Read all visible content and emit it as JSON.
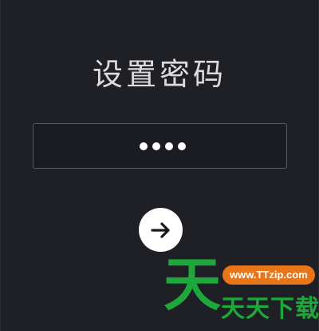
{
  "title": "设置密码",
  "password": {
    "masked_value": "••••",
    "length": 4
  },
  "next_button": {
    "icon": "arrow-right-icon"
  },
  "watermark": {
    "logo_char": "天",
    "url": "www.TTzip.com",
    "text": "天天下载",
    "colors": {
      "green": "#1ea83b",
      "orange": "#e9751a"
    }
  },
  "colors": {
    "background": "#1e2026",
    "text": "#dcdcdc",
    "border": "#565a62"
  }
}
